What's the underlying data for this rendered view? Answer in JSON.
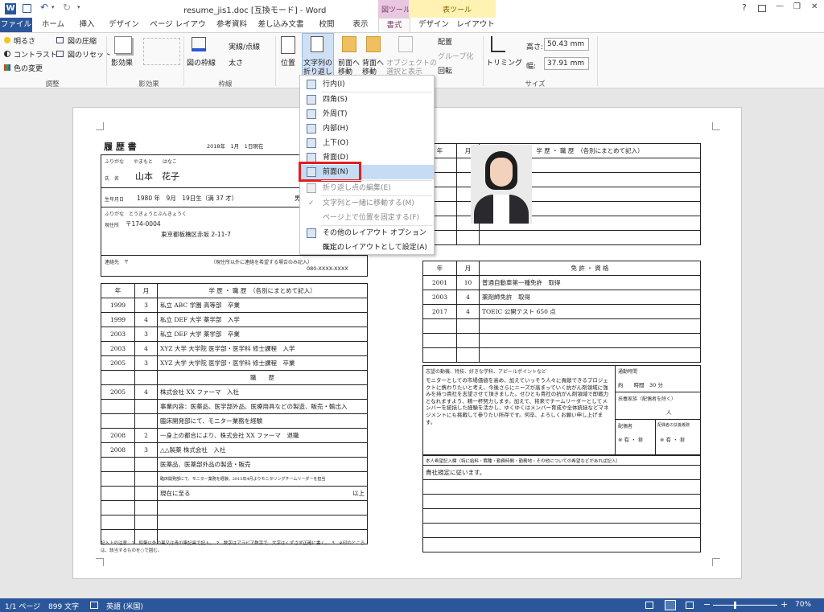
{
  "window": {
    "title": "resume_jis1.doc [互換モード] - Word",
    "context_tab_picture": "図ツール",
    "context_tab_table": "表ツール",
    "help": "?",
    "minimize": "—",
    "restore": "❐",
    "close": "✕",
    "signin": "サインイン"
  },
  "tabs": {
    "file": "ファイル",
    "home": "ホーム",
    "insert": "挿入",
    "design": "デザイン",
    "page_layout": "ページ レイアウト",
    "references": "参考資料",
    "mailings": "差し込み文書",
    "review": "校閲",
    "view": "表示",
    "format": "書式",
    "table_design": "デザイン",
    "table_layout": "レイアウト"
  },
  "ribbon": {
    "brightness": "明るさ",
    "contrast": "コントラスト",
    "recolor": "色の変更",
    "compress": "図の圧縮",
    "reset": "図のリセット",
    "adjust_group": "調整",
    "shadow": "影効果",
    "shadow_group": "影効果",
    "border": "図の枠線",
    "line_style": "実線/点線",
    "weight": "太さ",
    "border_group": "枠線",
    "position": "位置",
    "wrap_text_1": "文字列の",
    "wrap_text_2": "折り返し",
    "bring_forward_1": "前面へ",
    "bring_forward_2": "移動",
    "send_backward_1": "背面へ",
    "send_backward_2": "移動",
    "selection_1": "オブジェクトの",
    "selection_2": "選択と表示",
    "align": "配置",
    "group": "グループ化",
    "rotate": "回転",
    "crop": "トリミング",
    "height_label": "高さ:",
    "height_value": "50.43 mm",
    "width_label": "幅:",
    "width_value": "37.91 mm",
    "size_group": "サイズ"
  },
  "menu": {
    "items": [
      {
        "label": "行内(I)",
        "disabled": false
      },
      {
        "label": "四角(S)",
        "disabled": false
      },
      {
        "label": "外周(T)",
        "disabled": false
      },
      {
        "label": "内部(H)",
        "disabled": false
      },
      {
        "label": "上下(O)",
        "disabled": false
      },
      {
        "label": "背面(D)",
        "disabled": false
      },
      {
        "label": "前面(N)",
        "disabled": false
      },
      {
        "label": "折り返し点の編集(E)",
        "disabled": true
      },
      {
        "label": "文字列と一緒に移動する(M)",
        "disabled": true
      },
      {
        "label": "ページ上で位置を固定する(F)",
        "disabled": true
      },
      {
        "label": "その他のレイアウト オプション(L)...",
        "disabled": false
      },
      {
        "label": "既定のレイアウトとして設定(A)",
        "disabled": false
      }
    ],
    "check": "✓"
  },
  "resume": {
    "title": "履 歴 書",
    "date": "2018年　1月　1日現在",
    "furigana_label": "ふりがな　　やまもと　　はなこ",
    "name_label": "氏　名",
    "name": "山本　花子",
    "birth_label": "生年月日",
    "birth": "1980 年　9月　19日生（満 37 才）",
    "sex": "男・㊛",
    "furigana2": "ふりがな　とうきょうとぶんきょうく",
    "addr_label": "現住所",
    "postal": "〒174-0004",
    "address": "東京都板橋区赤坂 2-11-7",
    "contact_label": "連絡先　〒",
    "contact_note": "（現住所以外に連絡を希望する場合のみ記入）",
    "tel": "080-XXXX-XXXX",
    "hdr_year": "年",
    "hdr_month": "月",
    "hdr_history": "学 歴 ・ 職 歴　（各別にまとめて記入）",
    "education": [
      {
        "y": "1999",
        "m": "3",
        "t": "私立 ABC 学園 高等部　卒業"
      },
      {
        "y": "1999",
        "m": "4",
        "t": "私立 DEF 大学 薬学部　入学"
      },
      {
        "y": "2003",
        "m": "3",
        "t": "私立 DEF 大学 薬学部　卒業"
      },
      {
        "y": "2003",
        "m": "4",
        "t": "XYZ 大学 大学院 医学部・医学科 修士課程　入学"
      },
      {
        "y": "2005",
        "m": "3",
        "t": "XYZ 大学 大学院 医学部・医学科 修士課程　卒業"
      }
    ],
    "work_header": "職　　歴",
    "work": [
      {
        "y": "2005",
        "m": "4",
        "t": "株式会社 XX ファーマ　入社"
      },
      {
        "y": "",
        "m": "",
        "t": "事業内容：医薬品、医学部外品、医療用具などの製造、販売・輸出入"
      },
      {
        "y": "",
        "m": "",
        "t": "臨床開発部にて、モニター業務を経験"
      },
      {
        "y": "2008",
        "m": "2",
        "t": "一身上の都合により、株式会社 XX ファーマ　退職"
      },
      {
        "y": "2008",
        "m": "3",
        "t": "△△製薬 株式会社　入社"
      },
      {
        "y": "",
        "m": "",
        "t": "医薬品、医薬部外品の製造・販売"
      },
      {
        "y": "",
        "m": "",
        "t": "臨床開発部にて、モニター業務を経験。2015年4月よりモニタリングチームリーダーを担当"
      },
      {
        "y": "",
        "m": "",
        "t": "現在に至る"
      }
    ],
    "ijo": "以上",
    "footer_note": "記入上の注意　1．鉛筆以外の黒又は青の筆記具で記入。　2．数字はアラビア数字で、文字はくずさず正確に書く。　3．※印のところは、該当するものを○で囲む。",
    "right_hdr": "学 歴 ・ 職 歴　（各別にまとめて記入）",
    "lic_hdr": "免 許 ・ 資 格",
    "licenses": [
      {
        "y": "2001",
        "m": "10",
        "t": "普通自動車第一種免許　取得"
      },
      {
        "y": "2003",
        "m": "4",
        "t": "薬剤師免許　取得"
      },
      {
        "y": "2017",
        "m": "4",
        "t": "TOEIC 公開テスト 650 点"
      }
    ],
    "motive_label": "志望の動機、特技、好きな学科、アピールポイントなど",
    "motive_text": "モニターとしての市場価値を高め、加えていっそう人々に貢献できるプロジェクトに携わりたいと考え、今後さらにニーズが高まっていく抗がん剤領域に強みを持つ貴社を志望させて頂きました。せひとも貴社の抗がん剤領域で即戦力となれますよう、精一杯努力します。加えて、将来でチームリーダーとしてメンバーを統括した経験を活かし、ゆくゆくはメンバー育成や全体統括などマネジメントにも挑戦して参りたい所存です。何卒、よろしくお願い申し上げます。",
    "commute_label": "通勤時間",
    "commute": "約　　時間　30 分",
    "dependents_label": "扶養家族（配偶者を除く）",
    "dependents": "人",
    "spouse_label": "配偶者",
    "spouse": "※ 有 ・ ㊖",
    "spouse_duty_label": "配偶者の扶養義務",
    "spouse_duty": "※ 有 ・ ㊖",
    "wish_label": "本人希望記入欄（特に給料・職種・勤務時間・勤務地・その他についての希望などがあれば記入）",
    "wish": "貴社規定に従います。"
  },
  "status": {
    "page": "1/1 ページ",
    "words": "899 文字",
    "lang": "英語 (米国)",
    "zoom": "70%"
  },
  "colors": {
    "accent": "#2b579a",
    "context_picture": "#e8c8e0",
    "context_table": "#fff2b3",
    "highlight_box": "#e02020"
  }
}
